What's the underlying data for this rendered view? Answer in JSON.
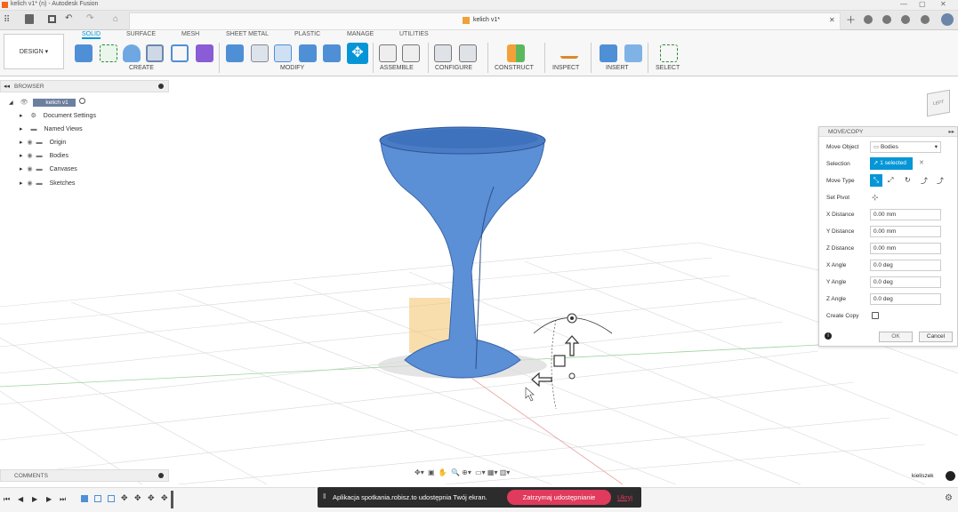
{
  "window": {
    "title": "kelich v1* (n) - Autodesk Fusion",
    "doc_tab": "kelich v1*"
  },
  "ribbon": {
    "workspace": "DESIGN",
    "tabs": [
      "SOLID",
      "SURFACE",
      "MESH",
      "SHEET METAL",
      "PLASTIC",
      "MANAGE",
      "UTILITIES"
    ],
    "groups": [
      "CREATE",
      "MODIFY",
      "ASSEMBLE",
      "CONFIGURE",
      "CONSTRUCT",
      "INSPECT",
      "INSERT",
      "SELECT"
    ]
  },
  "browser": {
    "title": "BROWSER",
    "root": "kelich v1",
    "items": [
      "Document Settings",
      "Named Views",
      "Origin",
      "Bodies",
      "Canvases",
      "Sketches"
    ]
  },
  "viewcube": {
    "label": "LEFT"
  },
  "move_copy": {
    "title": "MOVE/COPY",
    "move_object_label": "Move Object",
    "move_object_value": "Bodies",
    "selection_label": "Selection",
    "selection_value": "1 selected",
    "move_type_label": "Move Type",
    "set_pivot_label": "Set Pivot",
    "fields": [
      {
        "label": "X Distance",
        "value": "0.00 mm"
      },
      {
        "label": "Y Distance",
        "value": "0.00 mm"
      },
      {
        "label": "Z Distance",
        "value": "0.00 mm"
      },
      {
        "label": "X Angle",
        "value": "0.0 deg"
      },
      {
        "label": "Y Angle",
        "value": "0.0 deg"
      },
      {
        "label": "Z Angle",
        "value": "0.0 deg"
      }
    ],
    "create_copy_label": "Create Copy",
    "ok": "OK",
    "cancel": "Cancel"
  },
  "comments": {
    "title": "COMMENTS"
  },
  "user": {
    "name": "kieliszek"
  },
  "share_bar": {
    "message": "Aplikacja spotkania.robisz.to udostępnia Twój ekran.",
    "stop": "Zatrzymaj udostępnianie",
    "hide": "Ukryj"
  },
  "colors": {
    "accent": "#0696d7",
    "body": "#5b8fd6",
    "share_stop": "#e03a5c"
  }
}
